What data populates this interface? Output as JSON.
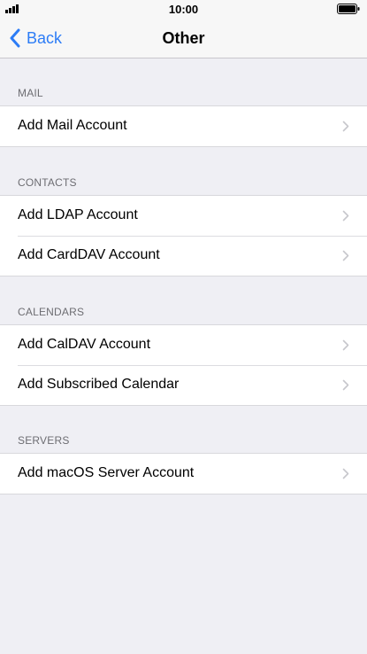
{
  "status_bar": {
    "time": "10:00",
    "signal_icon": "signal-bars-icon",
    "battery_icon": "battery-full-icon"
  },
  "nav": {
    "back_label": "Back",
    "back_icon": "chevron-left-icon",
    "title": "Other"
  },
  "colors": {
    "accent": "#2c7cf6",
    "background": "#efeff4",
    "section_header": "#6d6d72",
    "chevron": "#c7c7cc"
  },
  "sections": [
    {
      "header": "MAIL",
      "items": [
        {
          "label": "Add Mail Account"
        }
      ]
    },
    {
      "header": "CONTACTS",
      "items": [
        {
          "label": "Add LDAP Account"
        },
        {
          "label": "Add CardDAV Account"
        }
      ]
    },
    {
      "header": "CALENDARS",
      "items": [
        {
          "label": "Add CalDAV Account"
        },
        {
          "label": "Add Subscribed Calendar"
        }
      ]
    },
    {
      "header": "SERVERS",
      "items": [
        {
          "label": "Add macOS Server Account"
        }
      ]
    }
  ]
}
